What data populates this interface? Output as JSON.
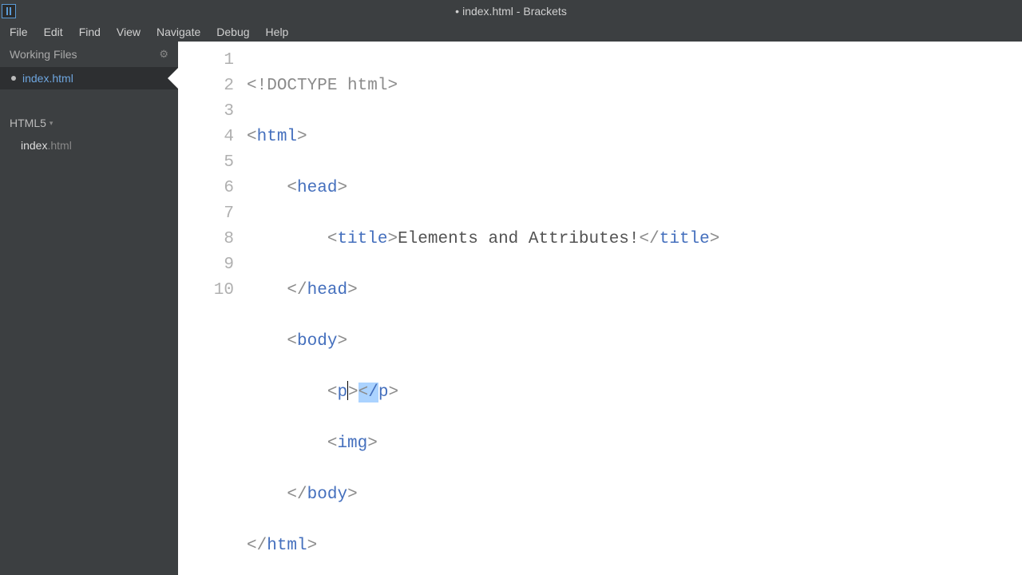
{
  "title": {
    "dirty_marker": "•",
    "filename": "index.html",
    "separator": " - ",
    "app_name": "Brackets"
  },
  "menu": {
    "file": "File",
    "edit": "Edit",
    "find": "Find",
    "view": "View",
    "navigate": "Navigate",
    "debug": "Debug",
    "help": "Help"
  },
  "sidebar": {
    "working_files_label": "Working Files",
    "working_file_name": "index.html",
    "folder_name": "HTML5",
    "tree_file_stem": "index",
    "tree_file_ext": ".html"
  },
  "code": {
    "lines": {
      "l1": {
        "num": "1"
      },
      "l2": {
        "num": "2"
      },
      "l3": {
        "num": "3"
      },
      "l4": {
        "num": "4",
        "text": "Elements and Attributes!"
      },
      "l5": {
        "num": "5"
      },
      "l6": {
        "num": "6"
      },
      "l7": {
        "num": "7"
      },
      "l8": {
        "num": "8"
      },
      "l9": {
        "num": "9"
      },
      "l10": {
        "num": "10"
      }
    },
    "tokens": {
      "doctype_open": "<!",
      "doctype_word": "DOCTYPE html",
      "doctype_close": ">",
      "lt": "<",
      "gt": ">",
      "lt_close": "</",
      "html": "html",
      "head": "head",
      "title": "title",
      "body": "body",
      "p": "p",
      "img": "img",
      "slash": "/"
    }
  }
}
